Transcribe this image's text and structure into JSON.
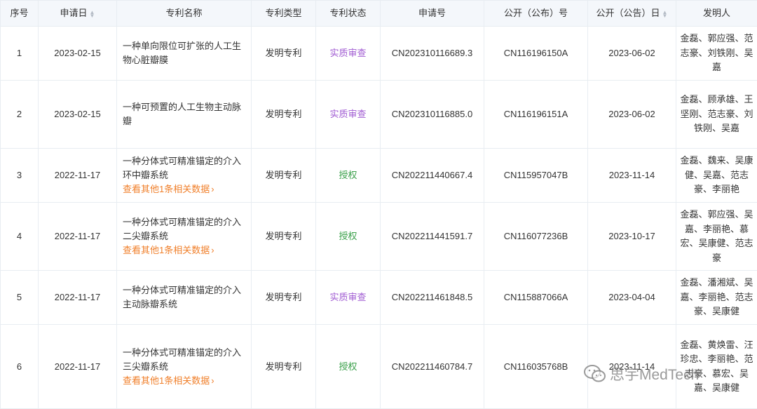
{
  "headers": {
    "seq": "序号",
    "app_date": "申请日",
    "name": "专利名称",
    "type": "专利类型",
    "status": "专利状态",
    "app_no": "申请号",
    "pub_no": "公开（公布）号",
    "pub_date": "公开（公告）日",
    "inventors": "发明人"
  },
  "colors": {
    "status_exam": "#a05bd2",
    "status_grant": "#3aa04a",
    "link": "#f07f2a",
    "header_bg": "#f4f7fb"
  },
  "rows": [
    {
      "seq": "1",
      "app_date": "2023-02-15",
      "name": "一种单向限位可扩张的人工生物心脏瓣膜",
      "more": "",
      "type": "发明专利",
      "status": "实质审查",
      "app_no": "CN202310116689.3",
      "pub_no": "CN116196150A",
      "pub_date": "2023-06-02",
      "inventors": "金磊、郭应强、范志豪、刘铁刚、吴嘉"
    },
    {
      "seq": "2",
      "app_date": "2023-02-15",
      "name": "一种可预置的人工生物主动脉瓣",
      "more": "",
      "type": "发明专利",
      "status": "实质审查",
      "app_no": "CN202310116885.0",
      "pub_no": "CN116196151A",
      "pub_date": "2023-06-02",
      "inventors": "金磊、顾承雄、王坚刚、范志豪、刘铁刚、吴嘉"
    },
    {
      "seq": "3",
      "app_date": "2022-11-17",
      "name": "一种分体式可精准锚定的介入环中瓣系统",
      "more": "查看其他1条相关数据",
      "type": "发明专利",
      "status": "授权",
      "app_no": "CN202211440667.4",
      "pub_no": "CN115957047B",
      "pub_date": "2023-11-14",
      "inventors": "金磊、魏来、吴康健、吴嘉、范志豪、李丽艳"
    },
    {
      "seq": "4",
      "app_date": "2022-11-17",
      "name": "一种分体式可精准锚定的介入二尖瓣系统",
      "more": "查看其他1条相关数据",
      "type": "发明专利",
      "status": "授权",
      "app_no": "CN202211441591.7",
      "pub_no": "CN116077236B",
      "pub_date": "2023-10-17",
      "inventors": "金磊、郭应强、吴嘉、李丽艳、慕宏、吴康健、范志豪"
    },
    {
      "seq": "5",
      "app_date": "2022-11-17",
      "name": "一种分体式可精准锚定的介入主动脉瓣系统",
      "more": "",
      "type": "发明专利",
      "status": "实质审查",
      "app_no": "CN202211461848.5",
      "pub_no": "CN115887066A",
      "pub_date": "2023-04-04",
      "inventors": "金磊、潘湘斌、吴嘉、李丽艳、范志豪、吴康健"
    },
    {
      "seq": "6",
      "app_date": "2022-11-17",
      "name": "一种分体式可精准锚定的介入三尖瓣系统",
      "more": "查看其他1条相关数据",
      "type": "发明专利",
      "status": "授权",
      "app_no": "CN202211460784.7",
      "pub_no": "CN116035768B",
      "pub_date": "2023-11-14",
      "inventors": "金磊、黄焕雷、汪珍忠、李丽艳、范志豪、慕宏、吴嘉、吴康健"
    }
  ],
  "watermark": "思宇MedTech"
}
